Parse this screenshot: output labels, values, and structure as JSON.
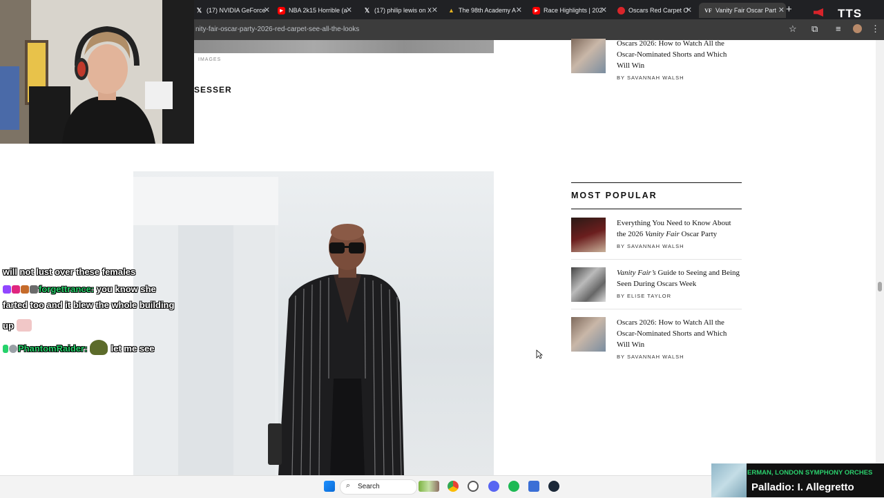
{
  "browser": {
    "tabs": [
      {
        "label": "(17) NVIDIA GeForce",
        "icon": "x-logo-icon"
      },
      {
        "label": "NBA 2k15 Horrible (a",
        "icon": "youtube-icon"
      },
      {
        "label": "(17) philip lewis on X",
        "icon": "x-logo-icon"
      },
      {
        "label": "The 98th Academy A",
        "icon": "academy-icon"
      },
      {
        "label": "Race Highlights | 202",
        "icon": "youtube-icon"
      },
      {
        "label": "Oscars Red Carpet O",
        "icon": "red-circle-icon"
      },
      {
        "label": "Vanity Fair Oscar Part",
        "icon": "vf-icon"
      }
    ],
    "new_tab": "+",
    "url": "nity-fair-oscar-party-2026-red-carpet-see-all-the-looks",
    "tts_label": "TTS"
  },
  "article": {
    "photo_credit": "IMAGES",
    "section_heading": "SESSER"
  },
  "sidebar": {
    "top_article": {
      "title": "Oscars 2026: How to Watch All the Oscar-Nominated Shorts and Which Will Win",
      "byline": "BY SAVANNAH WALSH"
    },
    "most_popular_title": "MOST POPULAR",
    "items": [
      {
        "title_pre": "Everything You Need to Know About the 2026 ",
        "title_em": "Vanity Fair",
        "title_post": " Oscar Party",
        "byline": "BY SAVANNAH WALSH"
      },
      {
        "title_pre": "",
        "title_em": "Vanity Fair’s",
        "title_post": " Guide to Seeing and Being Seen During Oscars Week",
        "byline": "BY ELISE TAYLOR"
      },
      {
        "title_pre": "Oscars 2026: How to Watch All the Oscar-Nominated Shorts and Which Will Win",
        "title_em": "",
        "title_post": "",
        "byline": "BY SAVANNAH WALSH"
      }
    ]
  },
  "chat": {
    "line1": "will not lust over these females",
    "msg2_nick": "forgettrance:",
    "msg2_text_a": " you know she",
    "msg2_text_b": "farted too and it blew the whole building",
    "msg2_text_c": "up",
    "msg3_nick": "PhantomRaider:",
    "msg3_text": " let me see"
  },
  "taskbar": {
    "search_label": "Search"
  },
  "music": {
    "artist": "ERMAN, LONDON SYMPHONY ORCHES",
    "track": "Palladio: I. Allegretto"
  },
  "colors": {
    "chat_nick": "#26d26b",
    "music_artist": "#2bd06d",
    "tab_bar": "#202124"
  }
}
